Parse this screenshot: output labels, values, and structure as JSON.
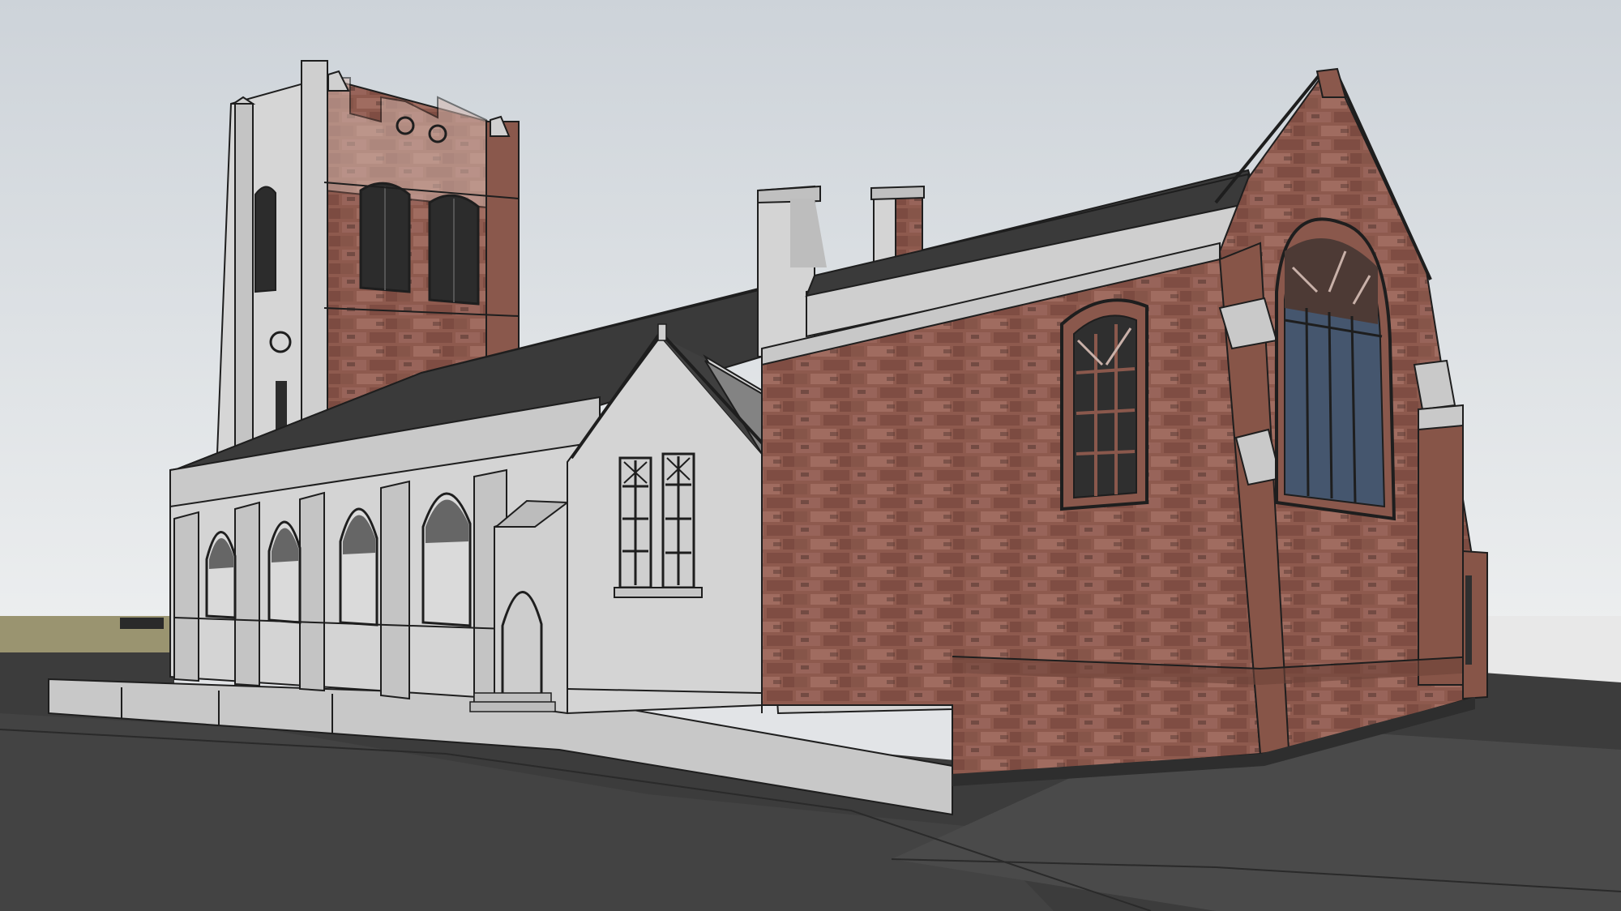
{
  "scene": {
    "subject": "3d-model-church",
    "colors": {
      "sky_top": "#cdd3d9",
      "sky_bottom": "#eceeef",
      "ground": "#3c3c3c",
      "ground_light": "#555555",
      "roof": "#3a3a3a",
      "stone": "#d4d4d4",
      "stone_shade": "#bdbdbd",
      "brick": "#8e5a4e",
      "brick_dark": "#74463c",
      "window_glass": "#45566e",
      "outline": "#1e1e1e"
    }
  }
}
